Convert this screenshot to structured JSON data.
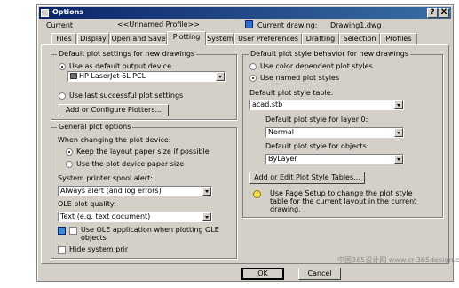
{
  "window": {
    "title": "Options",
    "help": "?",
    "close": "X"
  },
  "header": {
    "current_label": "Current",
    "profile_value": "<<Unnamed Profile>>",
    "drawing_label": "Current drawing:",
    "drawing_value": "Drawing1.dwg"
  },
  "tabs": [
    "Files",
    "Display",
    "Open and Save",
    "Plotting",
    "System",
    "User Preferences",
    "Drafting",
    "Selection",
    "Profiles"
  ],
  "left": {
    "defaults_title": "Default plot settings for new drawings",
    "use_default_device": "Use as default output device",
    "device_value": "HP LaserJet 6L PCL",
    "use_last": "Use last successful plot settings",
    "add_plotters": "Add or Configure Plotters...",
    "general_title": "General plot options",
    "when_changing": "When changing the plot device:",
    "keep_layout": "Keep the layout paper size if possible",
    "use_device_paper": "Use the plot device paper size",
    "spool_label": "System printer spool alert:",
    "spool_value": "Always alert (and log errors)",
    "ole_quality_label": "OLE plot quality:",
    "ole_quality_value": "Text (e.g. text document)",
    "use_ole_app": "Use OLE application when plotting OLE objects",
    "hide_system": "Hide system printers"
  },
  "right": {
    "style_title": "Default plot style behavior for new drawings",
    "use_color": "Use color dependent plot styles",
    "use_named": "Use named plot styles",
    "default_table_label": "Default plot style table:",
    "default_table_value": "acad.stb",
    "layer0_label": "Default plot style for layer 0:",
    "layer0_value": "Normal",
    "objects_label": "Default plot style for objects:",
    "objects_value": "ByLayer",
    "add_edit_tables": "Add or Edit Plot Style Tables...",
    "tip": "Use Page Setup to change the plot style table for the current layout in the current drawing."
  },
  "footer": {
    "ok": "OK",
    "cancel": "Cancel"
  },
  "watermark": "中国365设计网 www.cn365design.com"
}
